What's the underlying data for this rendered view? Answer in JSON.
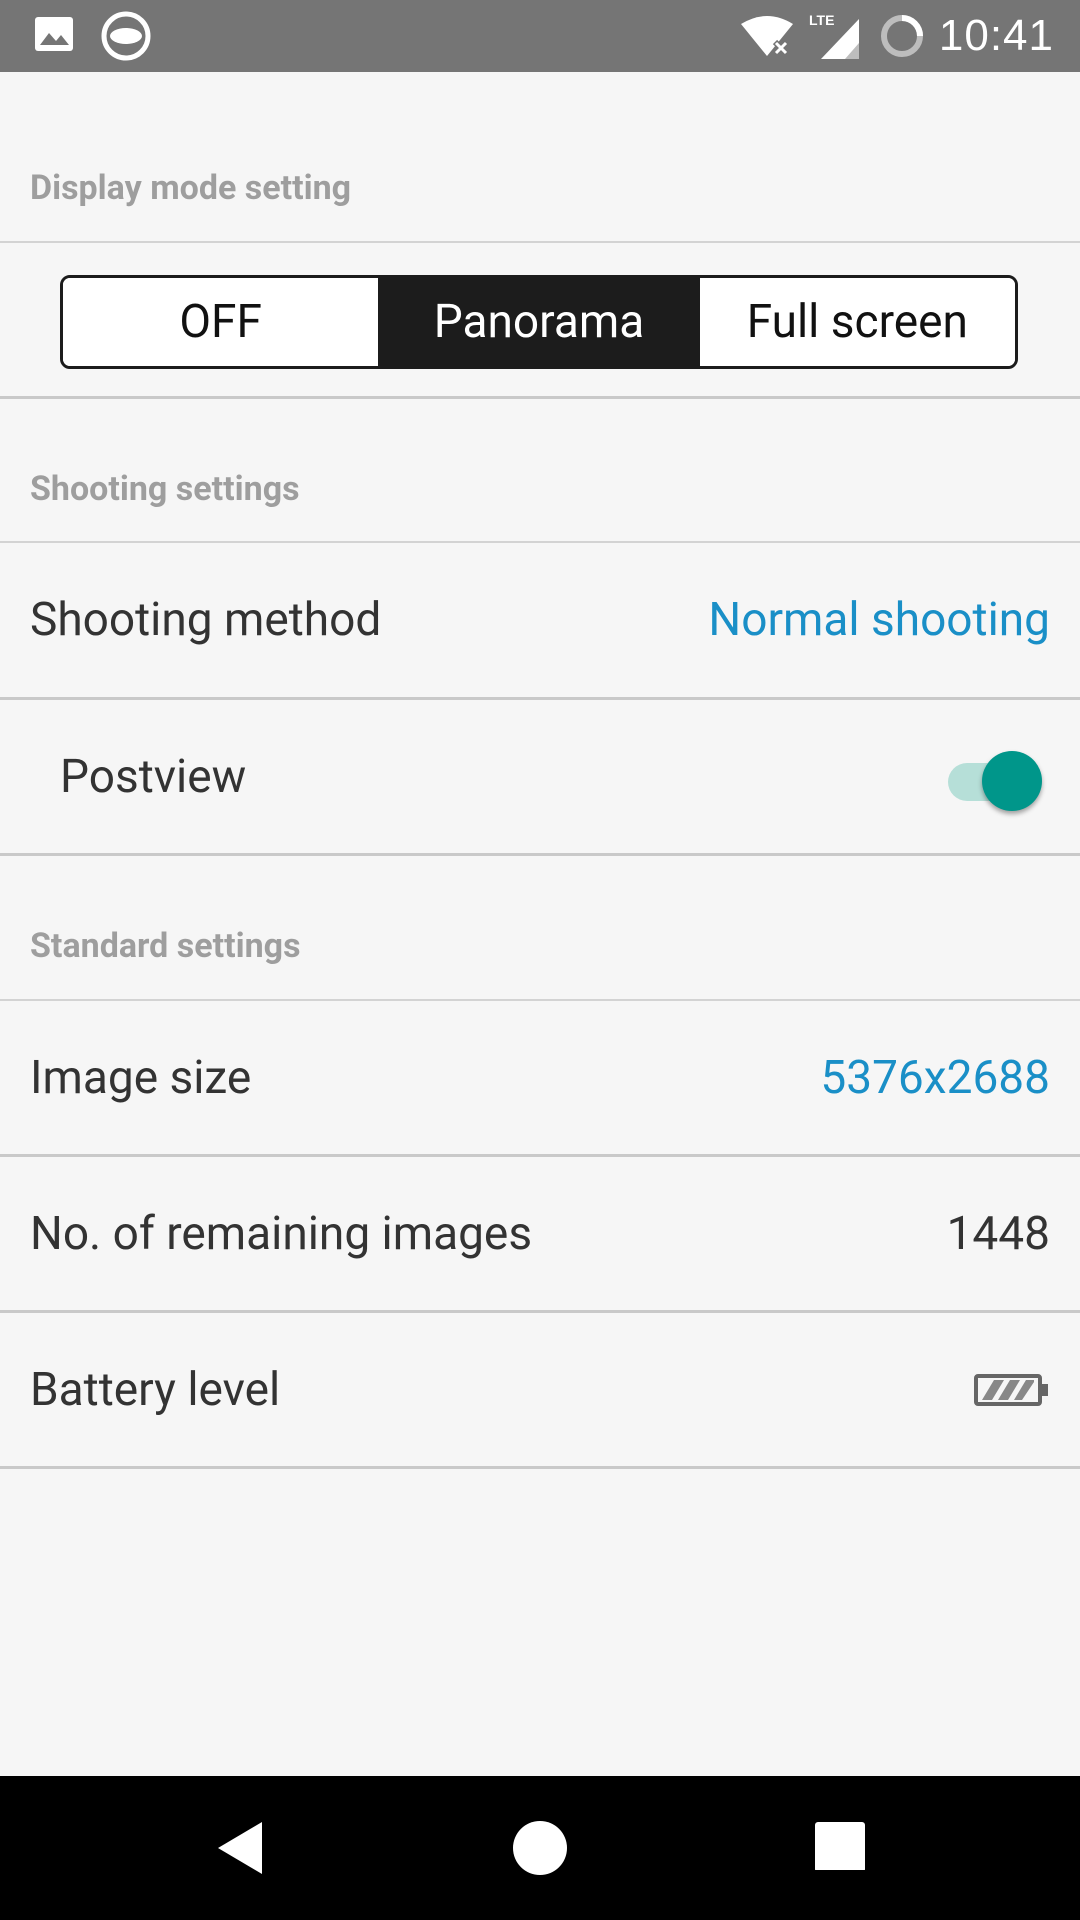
{
  "status_bar": {
    "time": "10:41",
    "left_icons": [
      "gallery-icon",
      "theta-icon"
    ],
    "right_icons": [
      "wifi-off-icon",
      "lte-signal-icon",
      "sync-circle-icon"
    ],
    "lte_label": "LTE"
  },
  "sections": {
    "display_mode": {
      "header": "Display mode setting",
      "options": [
        "OFF",
        "Panorama",
        "Full screen"
      ],
      "selected": "Panorama"
    },
    "shooting": {
      "header": "Shooting settings",
      "shooting_method": {
        "label": "Shooting method",
        "value": "Normal shooting"
      },
      "postview": {
        "label": "Postview",
        "enabled": true
      }
    },
    "standard": {
      "header": "Standard settings",
      "image_size": {
        "label": "Image size",
        "value": "5376x2688"
      },
      "remaining_images": {
        "label": "No. of remaining images",
        "value": "1448"
      },
      "battery_level": {
        "label": "Battery level",
        "icon": "battery-icon"
      }
    }
  },
  "colors": {
    "accent_link": "#1a8fc7",
    "toggle_on": "#00968a",
    "toggle_track": "#b6dfd8",
    "segment_active": "#1c1c1c",
    "header_text": "#9e9e9e"
  },
  "nav_bar": {
    "buttons": [
      "back-icon",
      "home-icon",
      "recents-icon"
    ]
  }
}
